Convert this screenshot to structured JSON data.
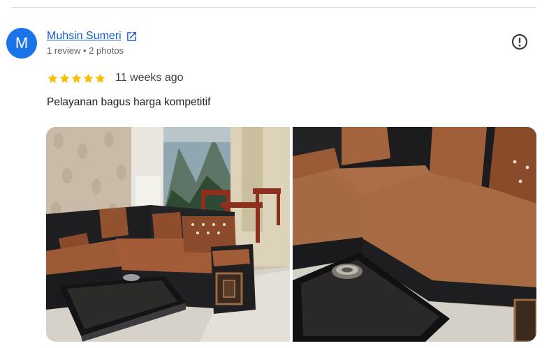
{
  "review": {
    "author": {
      "initial": "M",
      "name": "Muhsin Sumeri",
      "meta": "1 review • 2 photos",
      "avatar_color": "#1a73e8"
    },
    "rating": 5,
    "date": "11 weeks ago",
    "text": "Pelayanan bagus harga kompetitif",
    "star_color": "#fbbc04",
    "icons": {
      "external_link": "external-link-icon",
      "report": "report-icon",
      "star": "star-icon"
    },
    "photos": [
      {
        "name": "living room with brown and black sectional sofa, mountain mural and wooden chairs"
      },
      {
        "name": "close-up of brown and black sectional sofa with glass coffee table and ashtray"
      }
    ]
  }
}
